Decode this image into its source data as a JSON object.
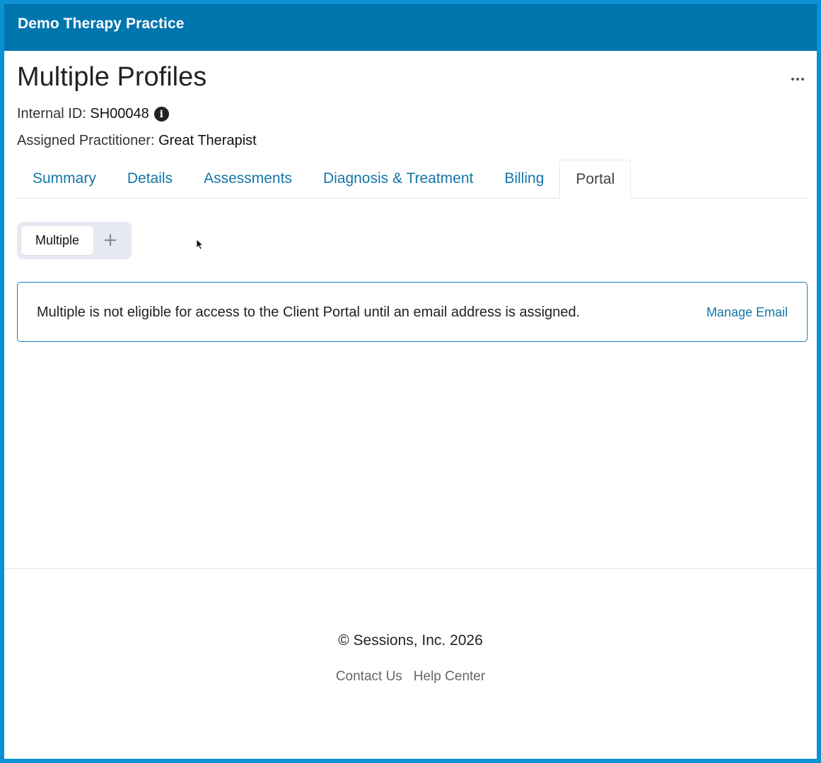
{
  "app": {
    "title": "Demo Therapy Practice"
  },
  "page": {
    "title": "Multiple Profiles",
    "internal_id_label": "Internal ID:",
    "internal_id": "SH00048",
    "practitioner_label": "Assigned Practitioner:",
    "practitioner": "Great Therapist"
  },
  "tabs": [
    {
      "label": "Summary"
    },
    {
      "label": "Details"
    },
    {
      "label": "Assessments"
    },
    {
      "label": "Diagnosis & Treatment"
    },
    {
      "label": "Billing"
    },
    {
      "label": "Portal",
      "active": true
    }
  ],
  "profiles": {
    "selected": "Multiple",
    "add_symbol": "+"
  },
  "notice": {
    "message": "Multiple is not eligible for access to the Client Portal until an email address is assigned.",
    "action": "Manage Email"
  },
  "footer": {
    "copyright": "© Sessions, Inc. 2026",
    "links": [
      "Contact Us",
      "Help Center"
    ]
  },
  "colors": {
    "header": "#0075ae",
    "link": "#1375a8",
    "frame": "#0c90d4"
  },
  "icons": {
    "info": "info-icon",
    "more": "more-horizontal-icon",
    "add": "plus-icon"
  }
}
